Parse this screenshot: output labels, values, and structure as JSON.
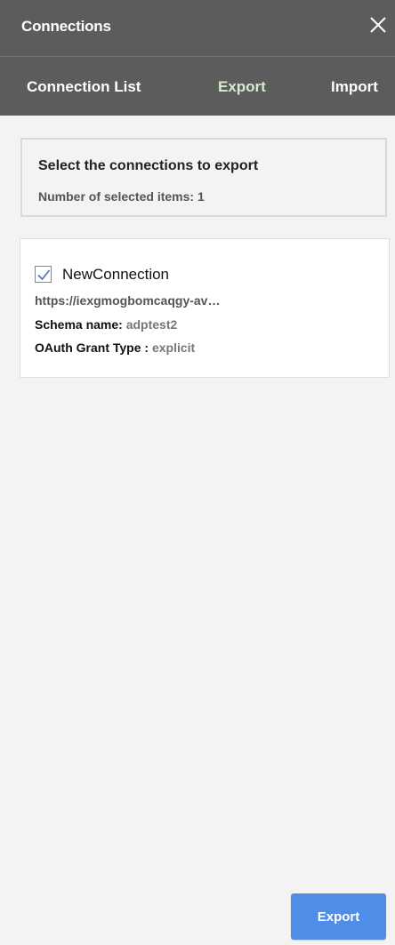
{
  "window": {
    "title": "Connections"
  },
  "tabs": [
    {
      "label": "Connection List",
      "active": false
    },
    {
      "label": "Export",
      "active": true
    },
    {
      "label": "Import",
      "active": false
    }
  ],
  "export_info": {
    "heading": "Select the connections to export",
    "count_text": "Number of selected items:  1"
  },
  "connections": [
    {
      "checked": true,
      "name": "NewConnection",
      "url": "https://iexgmogbomcaqgy-av…",
      "schema_label": "Schema name: ",
      "schema_value": "adptest2",
      "oauth_label": "OAuth Grant Type : ",
      "oauth_value": "explicit"
    }
  ],
  "footer": {
    "export_button": "Export"
  },
  "colors": {
    "header_bg": "#5c5c5c",
    "active_tab": "#d7ebcf",
    "primary_button": "#4f8ee8",
    "panel_bg": "#f3f3f3"
  }
}
